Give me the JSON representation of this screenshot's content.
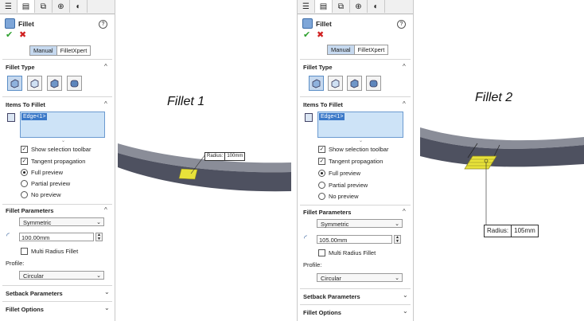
{
  "panel": {
    "title": "Fillet",
    "help_label": "?",
    "tabs": [
      "feature-manager-icon",
      "property-manager-icon",
      "configuration-manager-icon",
      "dim-xpert-icon",
      "display-manager-icon"
    ],
    "mode_tabs": {
      "manual": "Manual",
      "filletxpert": "FilletXpert"
    },
    "fillet_type": {
      "label": "Fillet Type"
    },
    "items_to_fillet": {
      "label": "Items To Fillet",
      "selected_item": "Edge<1>"
    },
    "options": {
      "show_selection_toolbar": "Show selection toolbar",
      "tangent_propagation": "Tangent propagation",
      "full_preview": "Full preview",
      "partial_preview": "Partial preview",
      "no_preview": "No preview"
    },
    "fillet_parameters": {
      "label": "Fillet Parameters",
      "method": "Symmetric",
      "multi_radius": "Multi Radius Fillet",
      "profile_label": "Profile:",
      "profile": "Circular"
    },
    "setback_parameters": "Setback Parameters",
    "fillet_options": "Fillet Options"
  },
  "left": {
    "radius": "100.00mm",
    "caption": "Fillet 1",
    "dim_label": "Radius:",
    "dim_value": "100mm"
  },
  "right": {
    "radius": "105.00mm",
    "caption": "Fillet 2",
    "dim_label": "Radius:",
    "dim_value": "105mm"
  },
  "colors": {
    "accent": "#3a78c8",
    "selection": "#e8e23a",
    "model": "#5a5d6a"
  }
}
